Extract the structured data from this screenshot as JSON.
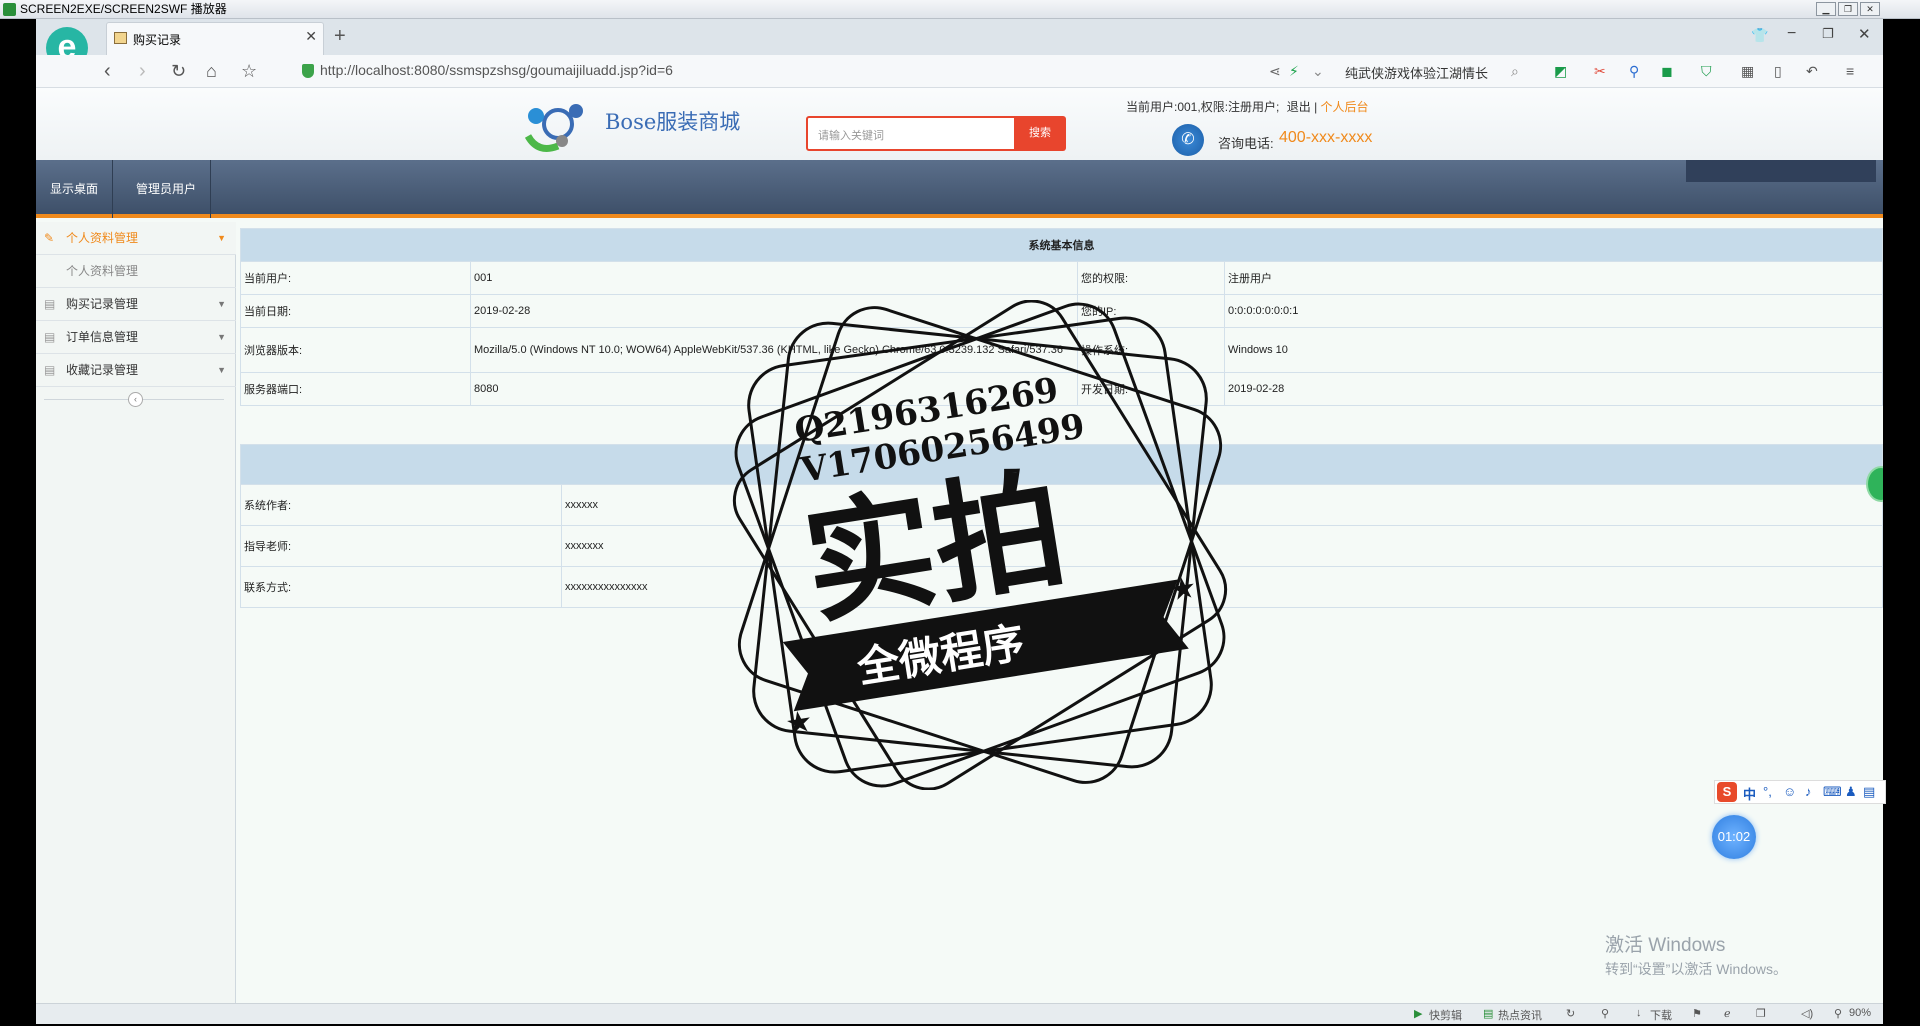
{
  "player": {
    "title": "SCREEN2EXE/SCREEN2SWF 播放器"
  },
  "browser": {
    "tab_title": "购买记录",
    "url": "http://localhost:8080/ssmspzshsg/goumaijiluadd.jsp?id=6",
    "url_host": "localhost",
    "search_hint": "纯武侠游戏体验江湖情长"
  },
  "site": {
    "brand": "Bose服装商城",
    "search_placeholder": "请输入关键词",
    "search_button": "搜索",
    "user_info": "当前用户:001,权限:注册用户;",
    "logout": "退出",
    "separator": "|",
    "personal_center": "个人后台",
    "phone_label": "咨询电话:",
    "phone": "400-xxx-xxxx"
  },
  "topnav": [
    "显示桌面",
    "管理员用户"
  ],
  "sidebar": {
    "items": [
      {
        "label": "个人资料管理",
        "active": true
      },
      {
        "label": "个人资料管理",
        "sub": true
      },
      {
        "label": "购买记录管理"
      },
      {
        "label": "订单信息管理"
      },
      {
        "label": "收藏记录管理"
      }
    ]
  },
  "system_info": {
    "title": "系统基本信息",
    "rows": [
      {
        "k1": "当前用户:",
        "v1": "001",
        "k2": "您的权限:",
        "v2": "注册用户"
      },
      {
        "k1": "当前日期:",
        "v1": "2019-02-28",
        "k2": "您的IP:",
        "v2": "0:0:0:0:0:0:0:1"
      },
      {
        "k1": "浏览器版本:",
        "v1": "Mozilla/5.0 (Windows NT 10.0; WOW64) AppleWebKit/537.36 (KHTML, like Gecko) Chrome/63.0.3239.132 Safari/537.36",
        "k2": "操作系统:",
        "v2": "Windows 10"
      },
      {
        "k1": "服务器端口:",
        "v1": "8080",
        "k2": "开发日期:",
        "v2": "2019-02-28"
      }
    ]
  },
  "dev_info": {
    "rows": [
      {
        "k": "系统作者:",
        "v": "xxxxxx"
      },
      {
        "k": "指导老师:",
        "v": "xxxxxxx"
      },
      {
        "k": "联系方式:",
        "v": "xxxxxxxxxxxxxxx"
      }
    ]
  },
  "stamp": {
    "line1": "Q2196316269",
    "line2": "V17060256499",
    "main": "实拍",
    "ribbon": "全微程序"
  },
  "float_timer": "01:02",
  "activation": {
    "line1": "激活 Windows",
    "line2": "转到“设置”以激活 Windows。"
  },
  "statusbar": {
    "items": [
      "快剪辑",
      "热点资讯",
      "下载"
    ],
    "zoom": "90%"
  },
  "colors": {
    "accent": "#f08a1c",
    "nav": "#44566f",
    "search_btn": "#e8452d",
    "brand_text": "#3a6cb5"
  }
}
